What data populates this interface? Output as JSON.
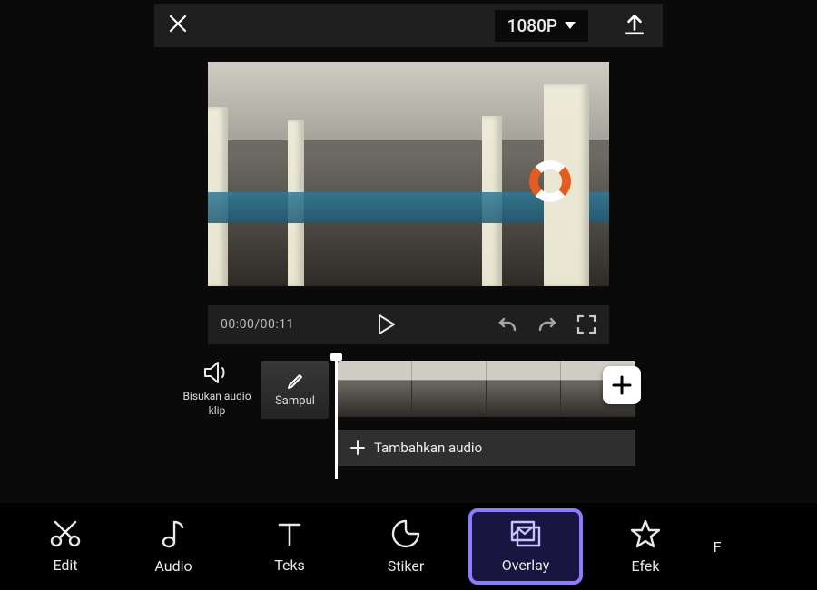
{
  "topbar": {
    "resolution_label": "1080P"
  },
  "transport": {
    "timecode": "00:00/00:11"
  },
  "controls": {
    "mute_label": "Bisukan audio klip",
    "cover_label": "Sampul",
    "add_audio_label": "Tambahkan audio"
  },
  "toolbar": {
    "items": [
      {
        "key": "edit",
        "label": "Edit"
      },
      {
        "key": "audio",
        "label": "Audio"
      },
      {
        "key": "teks",
        "label": "Teks"
      },
      {
        "key": "stiker",
        "label": "Stiker"
      },
      {
        "key": "overlay",
        "label": "Overlay",
        "active": true
      },
      {
        "key": "efek",
        "label": "Efek"
      }
    ],
    "overflow_hint": "F"
  }
}
